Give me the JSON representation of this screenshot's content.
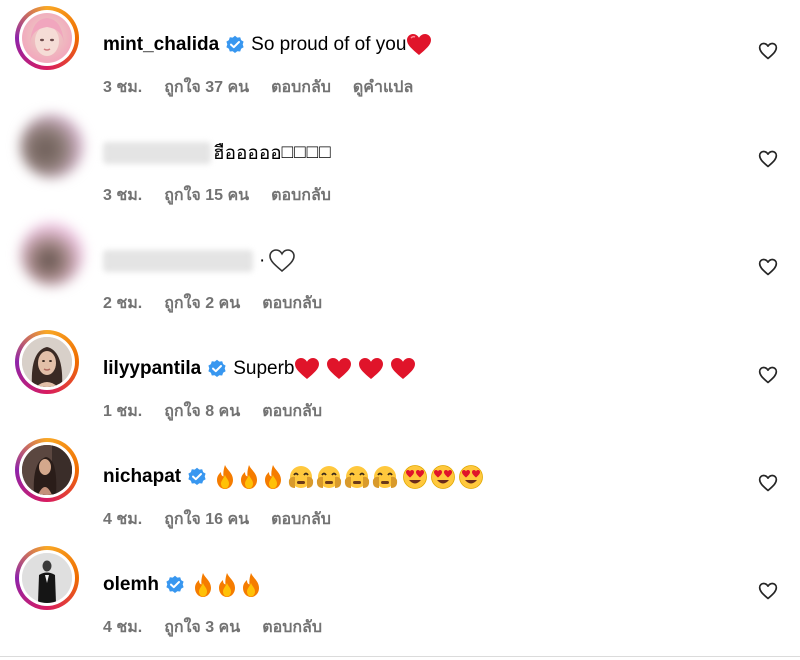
{
  "comments": [
    {
      "username": "mint_chalida",
      "verified": true,
      "text": "So proud of of you",
      "emojis": [
        "red-heart"
      ],
      "time": "3 ชม.",
      "likes": "ถูกใจ 37 คน",
      "reply": "ตอบกลับ",
      "translate": "ดูคำแปล"
    },
    {
      "username": "",
      "verified": false,
      "text": "ฮือออออ",
      "text_suffix": "□□□□",
      "time": "3 ชม.",
      "likes": "ถูกใจ 15 คน",
      "reply": "ตอบกลับ"
    },
    {
      "username": "",
      "verified": false,
      "text": "·",
      "emojis": [
        "white-heart"
      ],
      "time": "2 ชม.",
      "likes": "ถูกใจ 2 คน",
      "reply": "ตอบกลับ"
    },
    {
      "username": "lilyypantila",
      "verified": true,
      "text": "Superb",
      "emojis": [
        "red-heart",
        "red-heart",
        "red-heart",
        "red-heart"
      ],
      "time": "1 ชม.",
      "likes": "ถูกใจ 8 คน",
      "reply": "ตอบกลับ"
    },
    {
      "username": "nichapat",
      "verified": true,
      "text": "",
      "emojis": [
        "fire",
        "fire",
        "fire",
        "pleading-face",
        "pleading-face",
        "pleading-face",
        "pleading-face",
        "heart-eyes",
        "heart-eyes",
        "heart-eyes"
      ],
      "time": "4 ชม.",
      "likes": "ถูกใจ 16 คน",
      "reply": "ตอบกลับ"
    },
    {
      "username": "olemh",
      "verified": true,
      "text": "",
      "emojis": [
        "fire",
        "fire",
        "fire"
      ],
      "time": "4 ชม.",
      "likes": "ถูกใจ 3 คน",
      "reply": "ตอบกลับ"
    }
  ],
  "colors": {
    "verified": "#3897f0",
    "meta_text": "#737373",
    "heart_red": "#e0142a"
  },
  "icons": {
    "like": "heart-outline-icon",
    "verified": "verified-badge-icon"
  }
}
